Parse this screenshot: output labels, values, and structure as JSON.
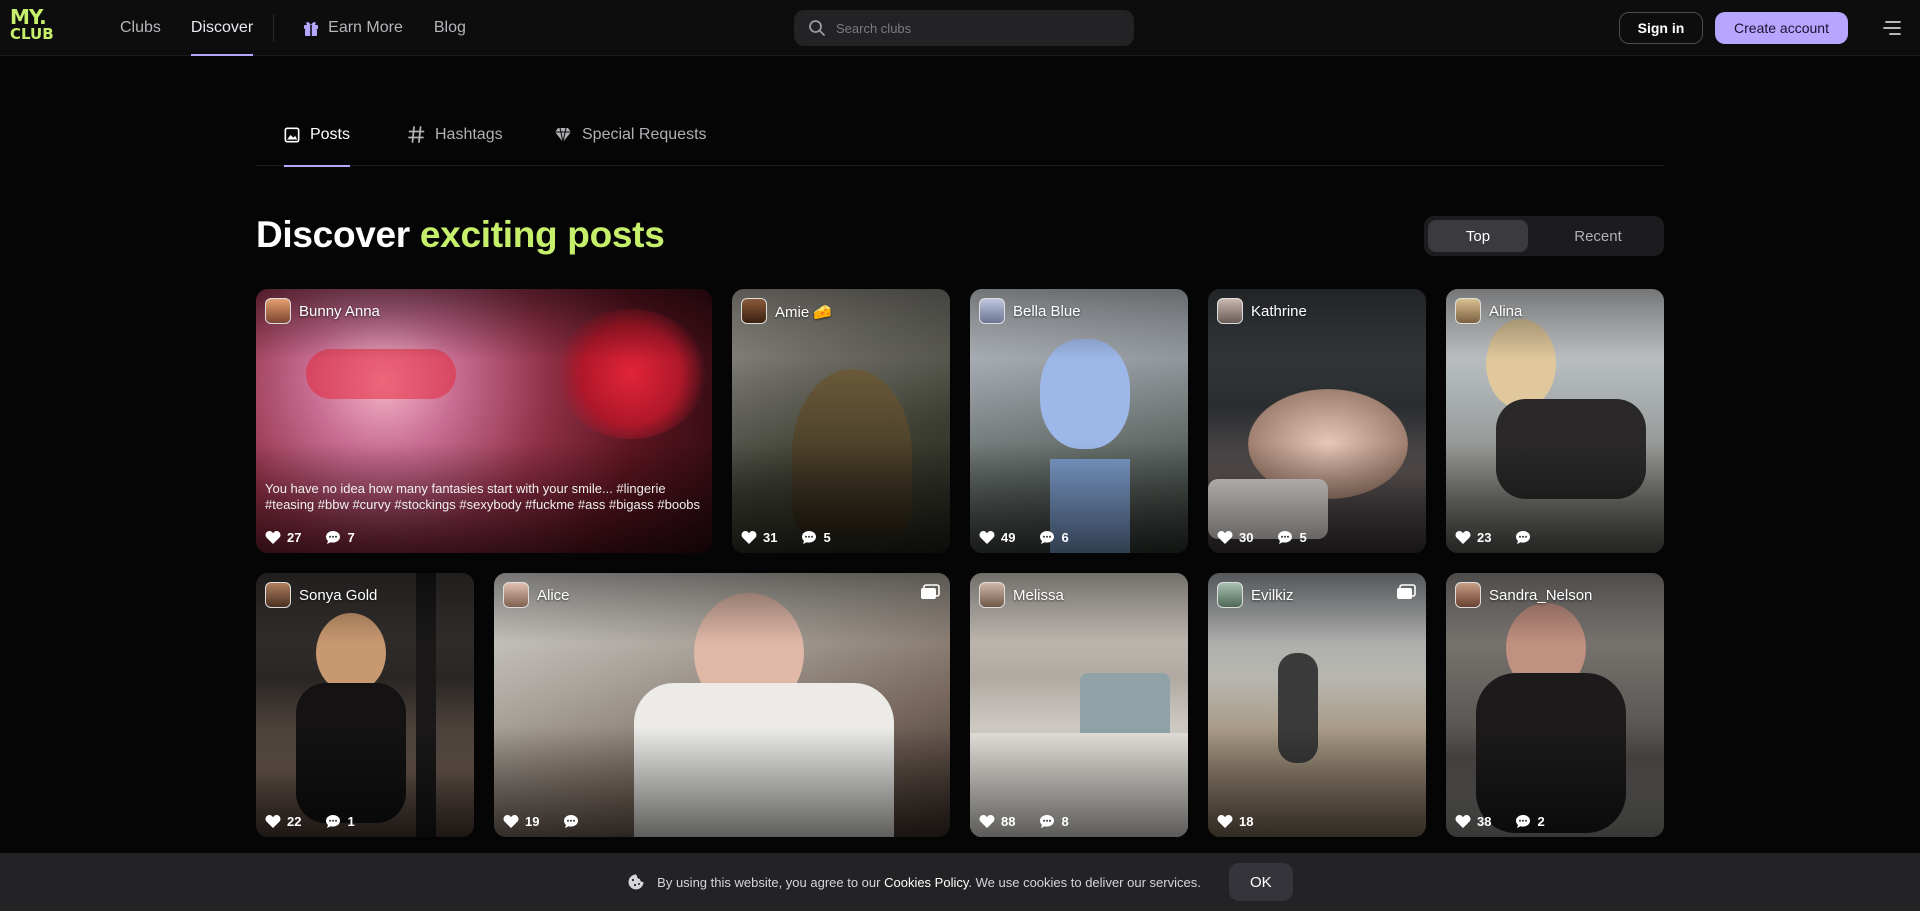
{
  "logo": {
    "line1": "MY.",
    "line2": "CLUB"
  },
  "nav": {
    "clubs": "Clubs",
    "discover": "Discover",
    "earn_more": "Earn More",
    "blog": "Blog"
  },
  "search": {
    "placeholder": "Search clubs"
  },
  "auth": {
    "sign_in": "Sign in",
    "create_account": "Create account"
  },
  "tabs": {
    "posts": "Posts",
    "hashtags": "Hashtags",
    "special_requests": "Special Requests"
  },
  "heading": {
    "prefix": "Discover",
    "accent": "exciting posts"
  },
  "sort": {
    "top": "Top",
    "recent": "Recent",
    "selected": "Top"
  },
  "posts": [
    {
      "author": "Bunny Anna",
      "caption": "You have no idea how many fantasies start with your smile... #lingerie #teasing #bbw #curvy #stockings #sexybody #fuckme #ass #bigass #boobs",
      "likes": "27",
      "comments": "7"
    },
    {
      "author": "Amie 🧀",
      "likes": "31",
      "comments": "5"
    },
    {
      "author": "Bella Blue",
      "likes": "49",
      "comments": "6"
    },
    {
      "author": "Kathrine",
      "likes": "30",
      "comments": "5"
    },
    {
      "author": "Alina",
      "likes": "23",
      "comments": ""
    },
    {
      "author": "Sonya Gold",
      "likes": "22",
      "comments": "1"
    },
    {
      "author": "Alice",
      "likes": "19",
      "comments": ""
    },
    {
      "author": "Melissa",
      "likes": "88",
      "comments": "8"
    },
    {
      "author": "Evilkiz",
      "likes": "18",
      "comments": null
    },
    {
      "author": "Sandra_Nelson",
      "likes": "38",
      "comments": "2"
    }
  ],
  "cookie": {
    "text_before": "By using this website, you agree to our",
    "policy_link": "Cookies Policy",
    "text_after": ". We use cookies to deliver our services.",
    "ok": "OK"
  },
  "colors": {
    "accent_lime": "#c6f06b",
    "accent_purple": "#b7a6ff",
    "background": "#050505"
  }
}
